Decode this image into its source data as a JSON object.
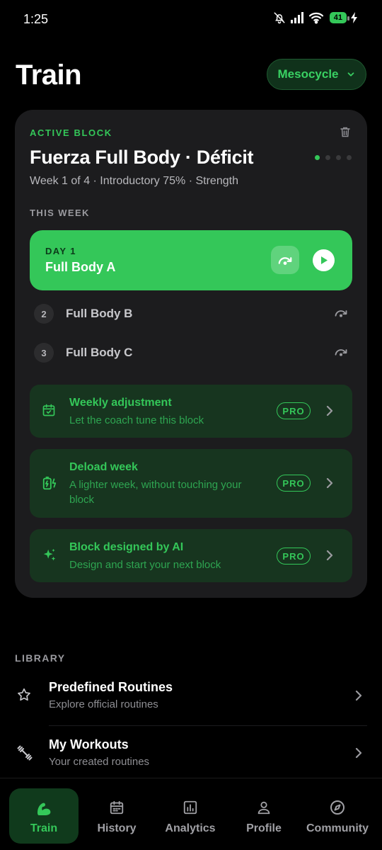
{
  "status_bar": {
    "time": "1:25",
    "battery": "41"
  },
  "header": {
    "title": "Train",
    "mesocycle_label": "Mesocycle"
  },
  "active_block": {
    "section_label": "ACTIVE BLOCK",
    "title": "Fuerza Full Body · Déficit",
    "subtitle": "Week 1 of 4 · Introductory 75% · Strength",
    "this_week_label": "THIS WEEK",
    "current_day": {
      "day_label": "DAY 1",
      "name": "Full Body A"
    },
    "days": [
      {
        "number": "2",
        "name": "Full Body B"
      },
      {
        "number": "3",
        "name": "Full Body C"
      }
    ],
    "pro_features": [
      {
        "title": "Weekly adjustment",
        "description": "Let the coach tune this block",
        "badge": "PRO",
        "icon": "calendar-check-icon"
      },
      {
        "title": "Deload week",
        "description": "A lighter week, without touching your block",
        "badge": "PRO",
        "icon": "battery-charging-icon"
      },
      {
        "title": "Block designed by AI",
        "description": "Design and start your next block",
        "badge": "PRO",
        "icon": "sparkles-icon"
      }
    ]
  },
  "library": {
    "label": "LIBRARY",
    "items": [
      {
        "title": "Predefined Routines",
        "subtitle": "Explore official routines",
        "icon": "star-icon"
      },
      {
        "title": "My Workouts",
        "subtitle": "Your created routines",
        "icon": "dumbbell-icon"
      }
    ]
  },
  "bottom_nav": {
    "items": [
      {
        "label": "Train",
        "icon": "muscle-icon",
        "active": true
      },
      {
        "label": "History",
        "icon": "calendar-icon"
      },
      {
        "label": "Analytics",
        "icon": "bar-chart-icon"
      },
      {
        "label": "Profile",
        "icon": "person-icon"
      },
      {
        "label": "Community",
        "icon": "compass-icon"
      }
    ]
  },
  "colors": {
    "accent": "#34c759",
    "background": "#000000",
    "card": "#1c1c1e",
    "pro_card": "#17351f"
  }
}
